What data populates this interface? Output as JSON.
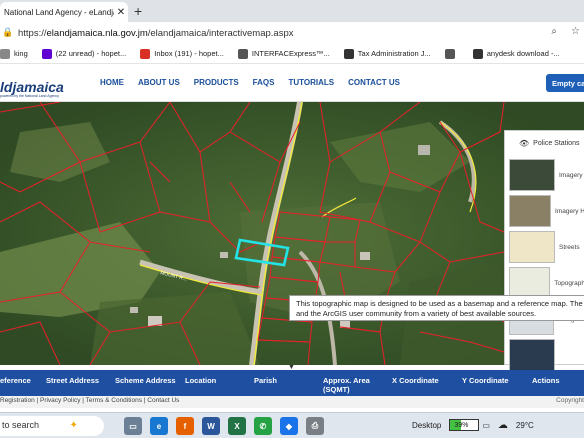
{
  "browser": {
    "tab_title": "National Land Agency - eLandjamaica",
    "url_prefix": "https://",
    "url_domain": "elandjamaica.nla.gov.jm",
    "url_path": "/elandjamaica/interactivemap.aspx"
  },
  "bookmarks": [
    {
      "label": "king",
      "icon": "bookmark-icon",
      "color": "#888888"
    },
    {
      "label": "(22 unread) - hopet...",
      "icon": "yahoo-icon",
      "color": "#6001d2"
    },
    {
      "label": "Inbox (191) - hopet...",
      "icon": "gmail-icon",
      "color": "#d93025"
    },
    {
      "label": "INTERFACExpress™...",
      "icon": "globe-icon",
      "color": "#555555"
    },
    {
      "label": "Tax Administration J...",
      "icon": "document-icon",
      "color": "#333333"
    },
    {
      "label": "",
      "icon": "globe-icon",
      "color": "#555555"
    },
    {
      "label": "anydesk download -...",
      "icon": "search-icon",
      "color": "#333333"
    }
  ],
  "site": {
    "logo": "ldjamaica",
    "logo_sub": "powered by the National Land Agency",
    "nav": [
      "HOME",
      "ABOUT US",
      "PRODUCTS",
      "FAQS",
      "TUTORIALS",
      "CONTACT US"
    ],
    "cta": "Empty cart"
  },
  "basemap_panel": {
    "title": "Police Stations",
    "items": [
      {
        "label": "Imagery",
        "color": "#3c4a3a"
      },
      {
        "label": "Imagery H",
        "color": "#8a8066"
      },
      {
        "label": "Streets",
        "color": "#efe6c8"
      },
      {
        "label": "Topograph",
        "color": "#e9ecdf"
      },
      {
        "label": "Navigatio",
        "color": "#d8dde2"
      },
      {
        "label": "",
        "color": "#2a3b4f"
      }
    ]
  },
  "tooltip": {
    "line1": "This topographic map is designed to be used as a basemap and a reference map. The ma",
    "line2": "and the ArcGIS user community from a variety of best available sources."
  },
  "map_label": "MOUNT R...",
  "table_headers": [
    "eference",
    "Street Address",
    "Scheme Address",
    "Location",
    "Parish",
    "Approx. Area",
    "(SQMT)",
    "X Coordinate",
    "Y Coordinate",
    "Actions"
  ],
  "footer": {
    "left": "Registration | Privacy Policy | Terms & Conditions | Contact Us",
    "right": "Copyright"
  },
  "taskbar": {
    "search": "to search",
    "desktop": "Desktop",
    "battery": "39%",
    "battery_level": 0.39,
    "temperature": "29°C"
  }
}
